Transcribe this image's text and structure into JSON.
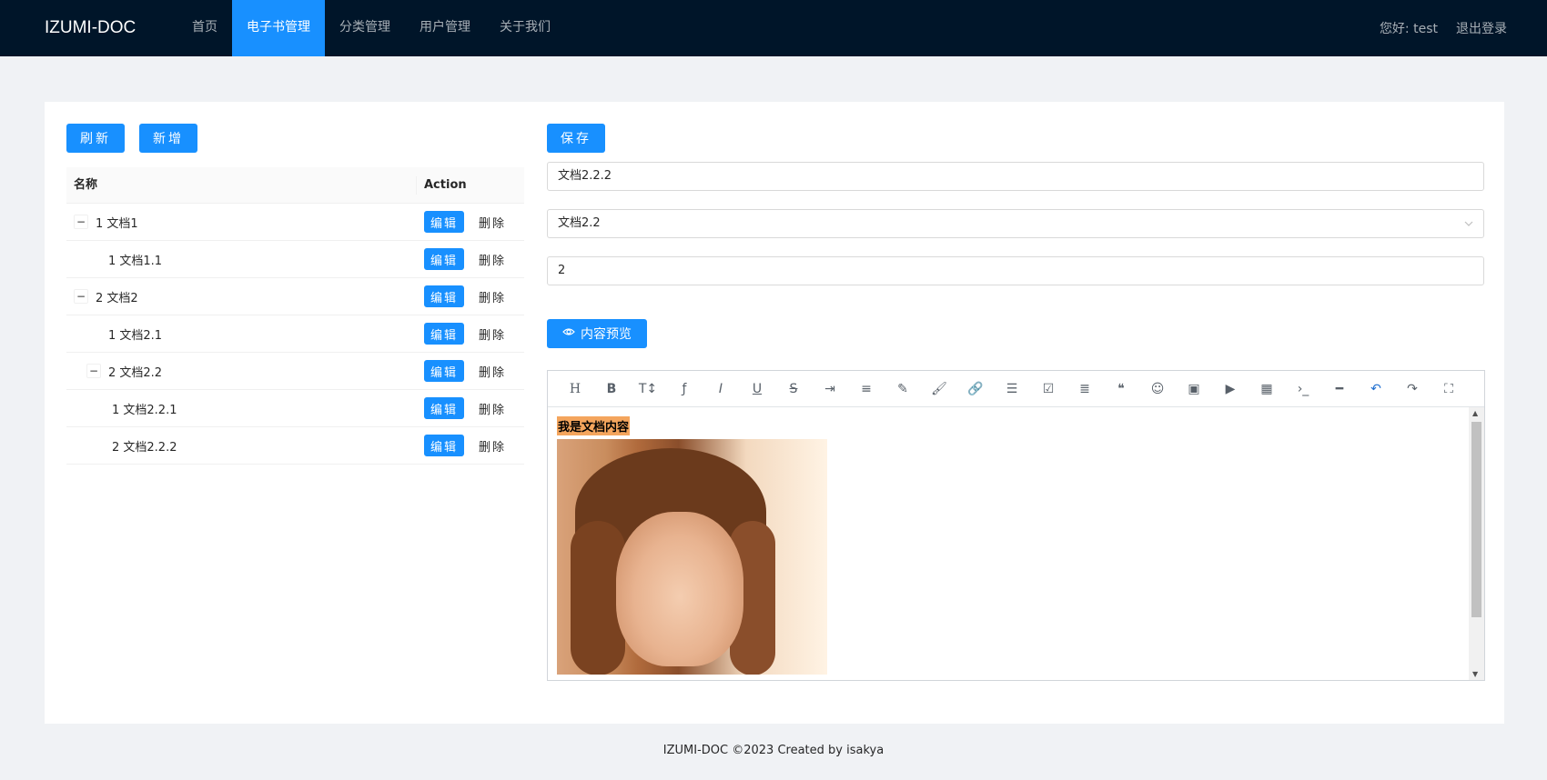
{
  "header": {
    "logo": "IZUMI-DOC",
    "nav": [
      {
        "label": "首页",
        "active": false
      },
      {
        "label": "电子书管理",
        "active": true
      },
      {
        "label": "分类管理",
        "active": false
      },
      {
        "label": "用户管理",
        "active": false
      },
      {
        "label": "关于我们",
        "active": false
      }
    ],
    "greeting": "您好: test",
    "logout": "退出登录"
  },
  "toolbar": {
    "refresh_label": "刷新",
    "add_label": "新增",
    "save_label": "保存"
  },
  "table": {
    "columns": [
      "名称",
      "Action"
    ],
    "edit_label": "编辑",
    "delete_label": "删除",
    "rows": [
      {
        "name": "1 文档1",
        "level": 0,
        "expandable": true
      },
      {
        "name": "1 文档1.1",
        "level": 1,
        "expandable": false
      },
      {
        "name": "2 文档2",
        "level": 0,
        "expandable": true
      },
      {
        "name": "1 文档2.1",
        "level": 1,
        "expandable": false
      },
      {
        "name": "2 文档2.2",
        "level": 1,
        "expandable": true
      },
      {
        "name": "1 文档2.2.1",
        "level": 2,
        "expandable": false
      },
      {
        "name": "2 文档2.2.2",
        "level": 2,
        "expandable": false
      }
    ]
  },
  "form": {
    "name_value": "文档2.2.2",
    "parent_value": "文档2.2",
    "sort_value": "2",
    "preview_label": "内容预览"
  },
  "editor": {
    "tools": [
      "heading-icon",
      "bold-icon",
      "font-size-icon",
      "font-family-icon",
      "italic-icon",
      "underline-icon",
      "strikethrough-icon",
      "indent-icon",
      "align-icon",
      "highlighter-icon",
      "brush-icon",
      "link-icon",
      "list-icon",
      "checkbox-icon",
      "text-align-icon",
      "quote-icon",
      "emoji-icon",
      "image-icon",
      "video-icon",
      "table-icon",
      "code-icon",
      "hr-icon",
      "undo-icon",
      "redo-icon",
      "fullscreen-icon"
    ],
    "content_text": "我是文档内容"
  },
  "footer": {
    "text": "IZUMI-DOC ©2023 Created by isakya"
  },
  "colors": {
    "primary": "#1890ff",
    "header_bg": "#001529",
    "highlight": "#f4a55d"
  }
}
